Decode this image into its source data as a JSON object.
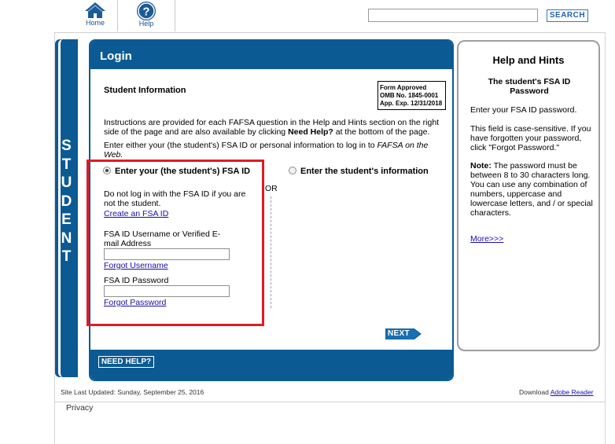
{
  "nav": {
    "home_label": "Home",
    "help_label": "Help",
    "search_value": "",
    "search_button": "SEARCH"
  },
  "student_bar": {
    "letters": [
      "S",
      "T",
      "U",
      "D",
      "E",
      "N",
      "T"
    ]
  },
  "login": {
    "header": "Login",
    "section_title": "Student Information",
    "omb": {
      "line1": "Form Approved",
      "line2": "OMB No. 1845-0001",
      "line3": "App. Exp. 12/31/2018"
    },
    "instructions_pre": "Instructions are provided for each FAFSA question in the Help and Hints section on the right side of the page and are also available by clicking ",
    "instructions_bold": "Need Help?",
    "instructions_post": " at the bottom of the page.",
    "choose_pre": "Enter either your (the student's) FSA ID or personal information to log in to ",
    "choose_italic": "FAFSA on the Web.",
    "option_fsa": "Enter your (the student's) FSA ID",
    "option_student": "Enter the student's information",
    "or_label": "OR",
    "fsa_note": "Do not log in with the FSA ID if you are not the student.",
    "create_link": "Create an FSA ID",
    "username_label": "FSA ID Username or Verified E-mail Address",
    "username_value": "",
    "forgot_username": "Forgot Username",
    "password_label": "FSA ID Password",
    "password_value": "",
    "forgot_password": "Forgot Password",
    "next_button": "NEXT",
    "need_help_button": "NEED HELP?"
  },
  "help_panel": {
    "title": "Help and Hints",
    "subtitle": "The student's FSA ID Password",
    "text1": "Enter your FSA ID password.",
    "text2": "This field is case-sensitive. If you have forgotten your password, click \"Forgot Password.\"",
    "note_label": "Note:",
    "note_text": " The password must be between 8 to 30 characters long. You can use any combination of numbers, uppercase and lowercase letters, and / or special characters.",
    "more_link": "More>>>"
  },
  "footer": {
    "last_updated": "Site Last Updated: Sunday, September 25, 2016",
    "download_label": "Download ",
    "download_link": "Adobe Reader",
    "privacy": "Privacy"
  },
  "colors": {
    "brand_blue": "#0c5a94",
    "highlight_red": "#e01b24",
    "link": "#1a0dab"
  }
}
